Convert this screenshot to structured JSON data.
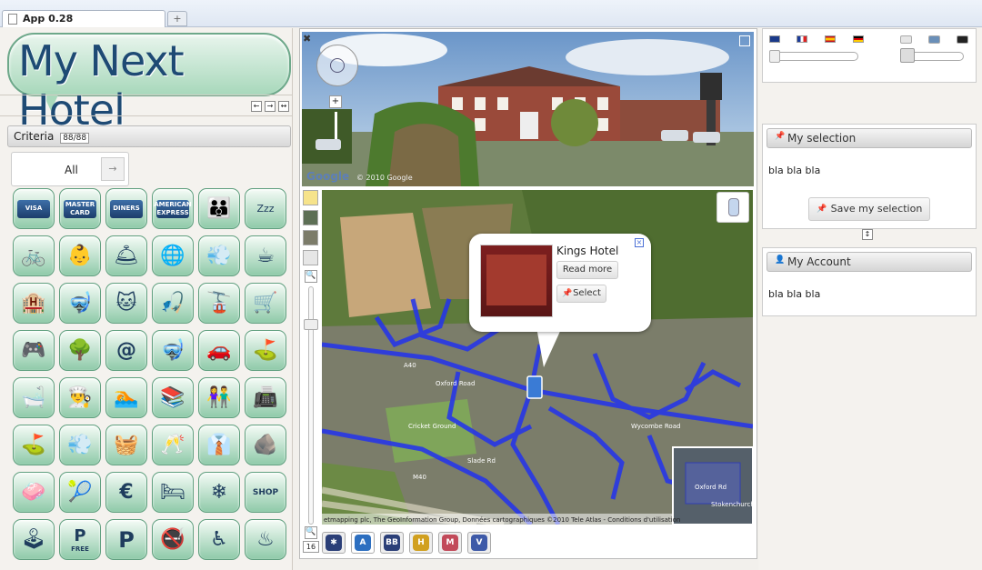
{
  "browser": {
    "tab_title": "App 0.28",
    "new_tab": "+"
  },
  "logo": {
    "text": "My Next Hotel"
  },
  "layout_arrows": [
    "←",
    "→",
    "↔"
  ],
  "criteria": {
    "label": "Criteria",
    "count": "88/88",
    "filter_value": "All",
    "filter_arrow": "→"
  },
  "cards": [
    "VISA",
    "MASTER CARD",
    "DINERS",
    "AMERICAN EXPRESS"
  ],
  "icons": [
    "visa-card-icon",
    "mastercard-icon",
    "diners-card-icon",
    "amex-card-icon",
    "family-icon",
    "sleep-bed-icon",
    "bicycle-icon",
    "stroller-icon",
    "room-service-icon",
    "globe-plane-icon",
    "hair-dryer-icon",
    "coffee-cup-icon",
    "hotel-building-icon",
    "snorkel-icon",
    "pet-cat-icon",
    "fishing-icon",
    "cable-car-icon",
    "luggage-trolley-icon",
    "gamepad-icon",
    "tree-icon",
    "internet-at-icon",
    "diving-mask-icon",
    "car-rental-icon",
    "golf-ball-tee-icon",
    "jacuzzi-icon",
    "chef-hat-icon",
    "swimming-pool-icon",
    "library-books-icon",
    "couple-icon",
    "fax-printer-icon",
    "mini-golf-icon",
    "hair-dryer-wall-icon",
    "iron-icon",
    "champagne-glasses-icon",
    "business-icon",
    "spa-stones-icon",
    "washing-machine-icon",
    "tennis-icon",
    "currency-exchange-icon",
    "honeymoon-bed-icon",
    "air-conditioning-icon",
    "shop-bag-icon",
    "joystick-icon",
    "parking-free-icon",
    "parking-icon",
    "no-smoking-icon",
    "wheelchair-icon",
    "sauna-icon"
  ],
  "icon_glyphs": [
    "",
    "",
    "",
    "",
    "👪",
    "Zzz",
    "🚲",
    "👶",
    "🛎",
    "🌐",
    "💨",
    "☕",
    "🏨",
    "🤿",
    "🐱",
    "🎣",
    "🚡",
    "🛒",
    "🎮",
    "🌳",
    "@",
    "🤿",
    "🚗",
    "⛳",
    "🛁",
    "👨‍🍳",
    "🏊",
    "📚",
    "👫",
    "📠",
    "⛳",
    "💨",
    "🧺",
    "🥂",
    "👔",
    "🪨",
    "🧼",
    "🎾",
    "€",
    "🛏",
    "❄",
    "SHOP",
    "🕹",
    "P",
    "P",
    "🚭",
    "♿",
    "♨"
  ],
  "parking_free_label": "FREE",
  "map": {
    "popup_title": "Kings Hotel",
    "read_more": "Read more",
    "select": "Select",
    "zoom_level": "16",
    "google_logo": "Google",
    "copyright_top": "© 2010 Google",
    "copyright_bottom": "etmapping plc, The GeoInformation Group, Données cartographiques ©2010 Tele Atlas - Conditions d'utilisation",
    "road_labels": [
      "Oxford Road",
      "A40",
      "Wycombe Road",
      "Cricket Ground",
      "Slade Rd",
      "M40",
      "Stokenchurch",
      "Oxford Rd"
    ],
    "bottom_buttons": [
      {
        "label": "✱",
        "color": "#2b3f78"
      },
      {
        "label": "A",
        "color": "#2d6fc0"
      },
      {
        "label": "BB",
        "color": "#2b3f78"
      },
      {
        "label": "H",
        "color": "#d1a020"
      },
      {
        "label": "M",
        "color": "#c24a5a"
      },
      {
        "label": "V",
        "color": "#3e5aa8"
      }
    ]
  },
  "languages": [
    "en-flag-icon",
    "fr-flag-icon",
    "es-flag-icon",
    "de-flag-icon"
  ],
  "theme_swatches": [
    "#e6e6e6",
    "#6a8fb8",
    "#222222"
  ],
  "selection": {
    "title": "My selection",
    "body": "bla bla bla",
    "save_button": "Save my selection"
  },
  "account": {
    "title": "My Account",
    "body": "bla bla bla"
  }
}
